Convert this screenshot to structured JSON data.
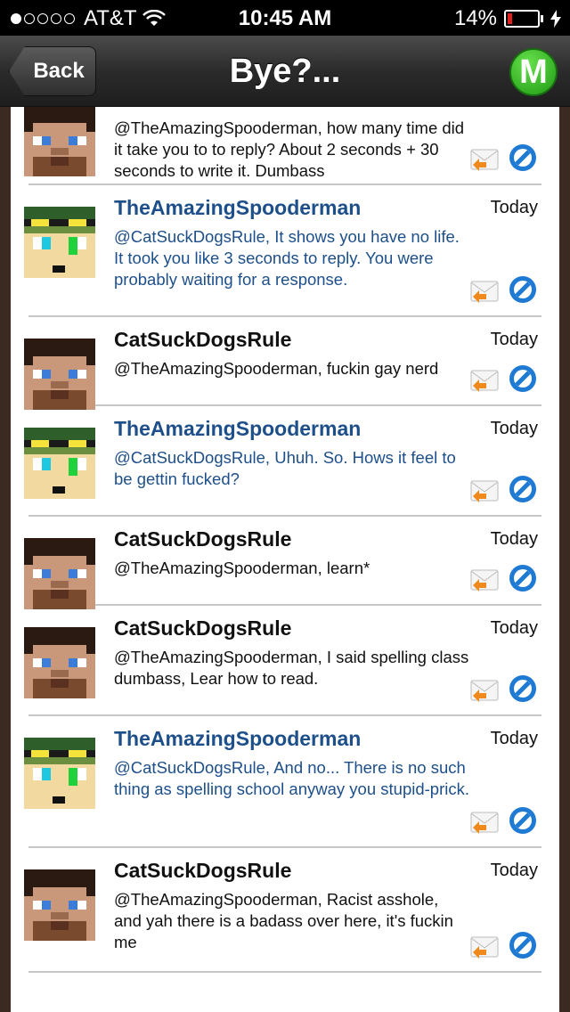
{
  "status_bar": {
    "carrier": "AT&T",
    "time": "10:45 AM",
    "battery": "14%",
    "battery_level": 0.14
  },
  "nav": {
    "back_label": "Back",
    "title": "Bye?...",
    "logo_letter": "M"
  },
  "messages": [
    {
      "username": "",
      "date": "",
      "text": "@TheAmazingSpooderman, how many time did it take you to to reply? About 2 seconds + 30 seconds to write it. Dumbass",
      "style": "cat"
    },
    {
      "username": "TheAmazingSpooderman",
      "date": "Today",
      "text": "@CatSuckDogsRule, It shows you have no life. It took you like 3 seconds to reply. You were probably waiting for a response.",
      "style": "spood"
    },
    {
      "username": "CatSuckDogsRule",
      "date": "Today",
      "text": "@TheAmazingSpooderman, fuckin gay nerd",
      "style": "cat"
    },
    {
      "username": "TheAmazingSpooderman",
      "date": "Today",
      "text": "@CatSuckDogsRule, Uhuh. So. Hows it feel to be gettin fucked?",
      "style": "spood"
    },
    {
      "username": "CatSuckDogsRule",
      "date": "Today",
      "text": "@TheAmazingSpooderman, learn*",
      "style": "cat"
    },
    {
      "username": "CatSuckDogsRule",
      "date": "Today",
      "text": "@TheAmazingSpooderman, I said spelling class dumbass, Lear how to read.",
      "style": "cat"
    },
    {
      "username": "TheAmazingSpooderman",
      "date": "Today",
      "text": "@CatSuckDogsRule, And no... There is no such thing as spelling school anyway you stupid-prick.",
      "style": "spood"
    },
    {
      "username": "CatSuckDogsRule",
      "date": "Today",
      "text": "@TheAmazingSpooderman, Racist asshole, and yah there is a badass over here, it's fuckin me",
      "style": "cat"
    }
  ],
  "colors": {
    "name_blue": "#1d4f8a",
    "divider": "#c8c8c8",
    "block_blue": "#1e7ad3",
    "reply_orange": "#f08a1c"
  },
  "icons": [
    "wifi-icon",
    "battery-icon",
    "back-arrow-icon",
    "m-logo-icon",
    "reply-icon",
    "block-icon",
    "avatar"
  ]
}
